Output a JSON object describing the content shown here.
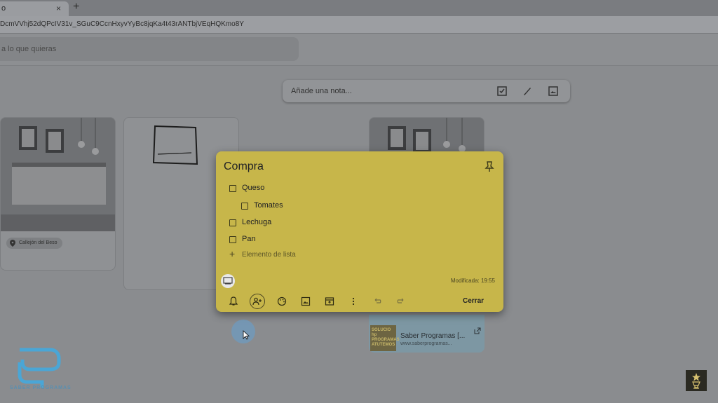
{
  "browser": {
    "tab_title": "o",
    "tab_close": "×",
    "new_tab": "+",
    "url": "DcmVVhj52dQPcIV31v_SGuC9CcnHxyvYyBc8jqKa4t43rANTbjVEqHQKmo8Y"
  },
  "app": {
    "search_placeholder": "a lo que quieras",
    "take_note_placeholder": "Añade una nota..."
  },
  "background_cards": {
    "location_chip": "Callejón del Beso",
    "link_title": "Saber Programas [...",
    "link_url": "www.saberprogramas...",
    "link_thumb_text": "SOLUCIO\nhp\nPROGRAMAS\nATUTEMOS"
  },
  "note": {
    "title": "Compra",
    "items": [
      {
        "label": "Queso",
        "checked": false,
        "indent": 0
      },
      {
        "label": "Tomates",
        "checked": false,
        "indent": 1
      },
      {
        "label": "Lechuga",
        "checked": false,
        "indent": 0
      },
      {
        "label": "Pan",
        "checked": false,
        "indent": 0
      }
    ],
    "add_item_label": "Elemento de lista",
    "modified_text": "Modificada: 19:55",
    "close_label": "Cerrar",
    "color": "#c7b64a"
  },
  "watermark": {
    "left_text": "SABER PROGRAMAS"
  }
}
